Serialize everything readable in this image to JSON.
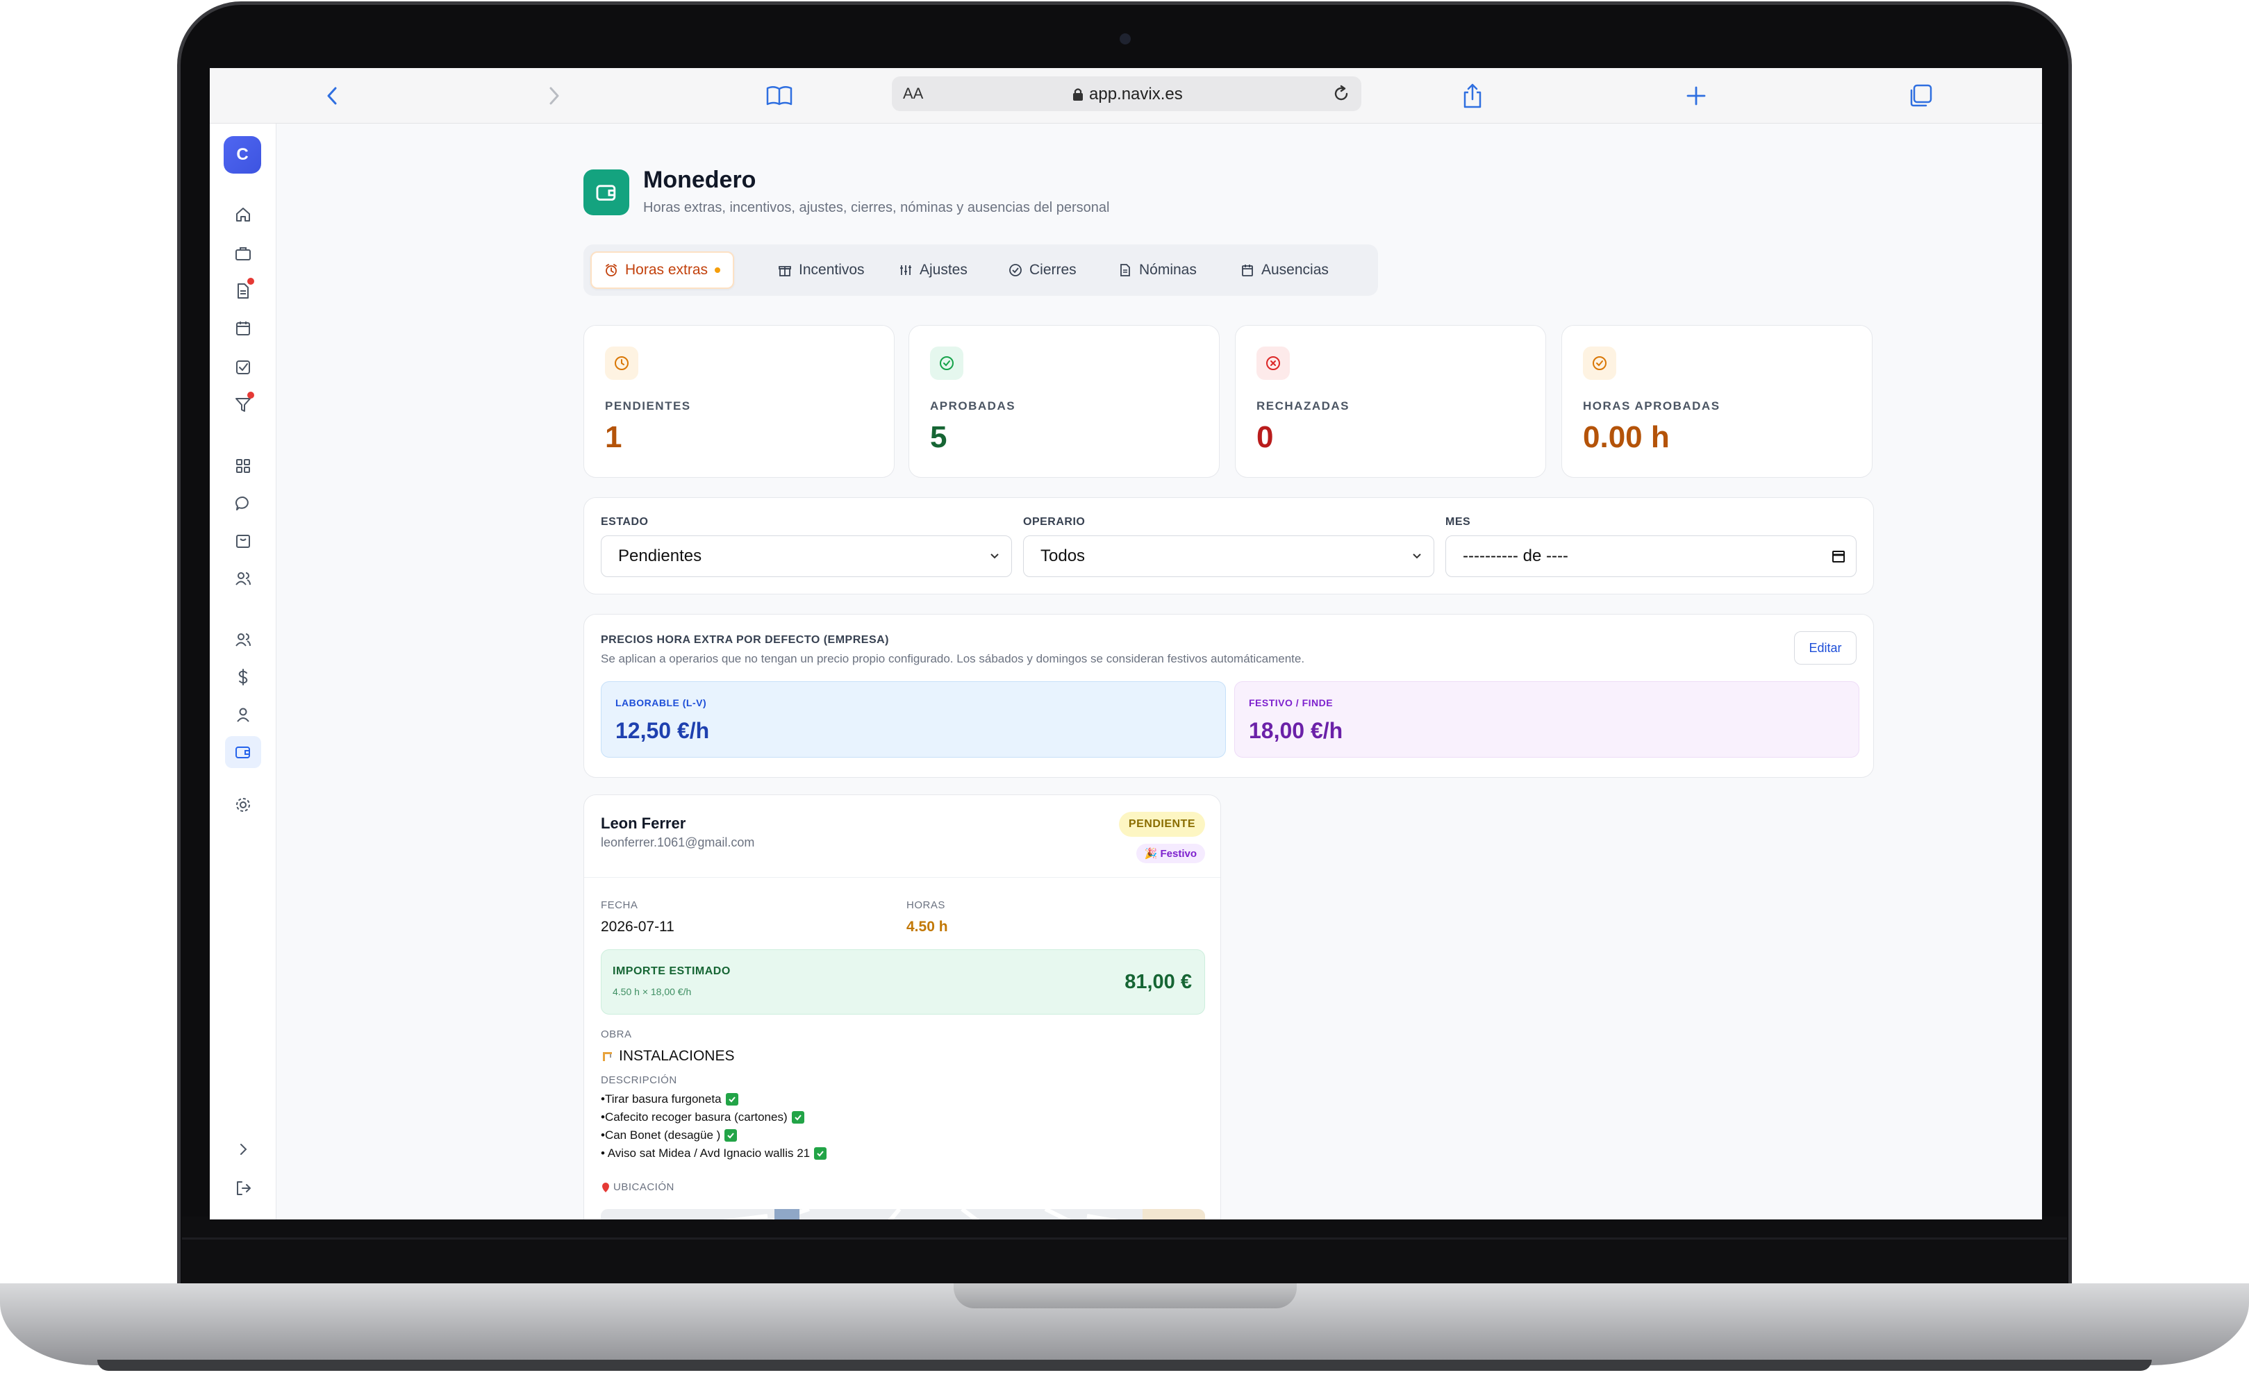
{
  "browser": {
    "reader_label": "AA",
    "url": "app.navix.es"
  },
  "sidebar": {
    "avatar_initial": "C"
  },
  "page": {
    "title": "Monedero",
    "subtitle": "Horas extras, incentivos, ajustes, cierres, nóminas y ausencias del personal"
  },
  "tabs": [
    {
      "label": "Horas extras",
      "icon": "alarm-clock-icon",
      "active": true
    },
    {
      "label": "Incentivos",
      "icon": "gift-icon"
    },
    {
      "label": "Ajustes",
      "icon": "sliders-icon"
    },
    {
      "label": "Cierres",
      "icon": "check-circle-icon"
    },
    {
      "label": "Nóminas",
      "icon": "document-icon"
    },
    {
      "label": "Ausencias",
      "icon": "calendar-icon"
    }
  ],
  "stats": [
    {
      "label": "PENDIENTES",
      "value": "1",
      "color": "#b45309",
      "icon": "clock-icon"
    },
    {
      "label": "APROBADAS",
      "value": "5",
      "color": "#166534",
      "icon": "check-circle-icon"
    },
    {
      "label": "RECHAZADAS",
      "value": "0",
      "color": "#b91c1c",
      "icon": "x-circle-icon"
    },
    {
      "label": "HORAS APROBADAS",
      "value": "0.00 h",
      "color": "#b45309",
      "icon": "clock-check-icon"
    }
  ],
  "filters": {
    "estado_label": "ESTADO",
    "estado_value": "Pendientes",
    "operario_label": "OPERARIO",
    "operario_value": "Todos",
    "mes_label": "MES",
    "mes_value": "---------- de ----"
  },
  "prices": {
    "title": "PRECIOS HORA EXTRA POR DEFECTO (EMPRESA)",
    "description": "Se aplican a operarios que no tengan un precio propio configurado. Los sábados y domingos se consideran festivos automáticamente.",
    "edit_label": "Editar",
    "laborable_label": "LABORABLE (L-V)",
    "laborable_value": "12,50 €/h",
    "festivo_label": "FESTIVO / FINDE",
    "festivo_value": "18,00 €/h"
  },
  "entry": {
    "name": "Leon Ferrer",
    "email": "leonferrer.1061@gmail.com",
    "status": "PENDIENTE",
    "day_type": "🎉 Festivo",
    "fecha_label": "FECHA",
    "fecha_value": "2026-07-11",
    "horas_label": "HORAS",
    "horas_value": "4.50 h",
    "importe_label": "IMPORTE ESTIMADO",
    "importe_calc": "4.50 h × 18,00 €/h",
    "importe_value": "81,00 €",
    "obra_label": "OBRA",
    "obra_value": "INSTALACIONES",
    "descripcion_label": "DESCRIPCIÓN",
    "descripcion_lines": [
      "•Tirar basura furgoneta",
      "•Cafecito recoger basura (cartones)",
      "•Can Bonet (desagüe )",
      "• Aviso sat Midea / Avd Ignacio wallis 21"
    ],
    "ubicacion_label": "UBICACIÓN"
  }
}
